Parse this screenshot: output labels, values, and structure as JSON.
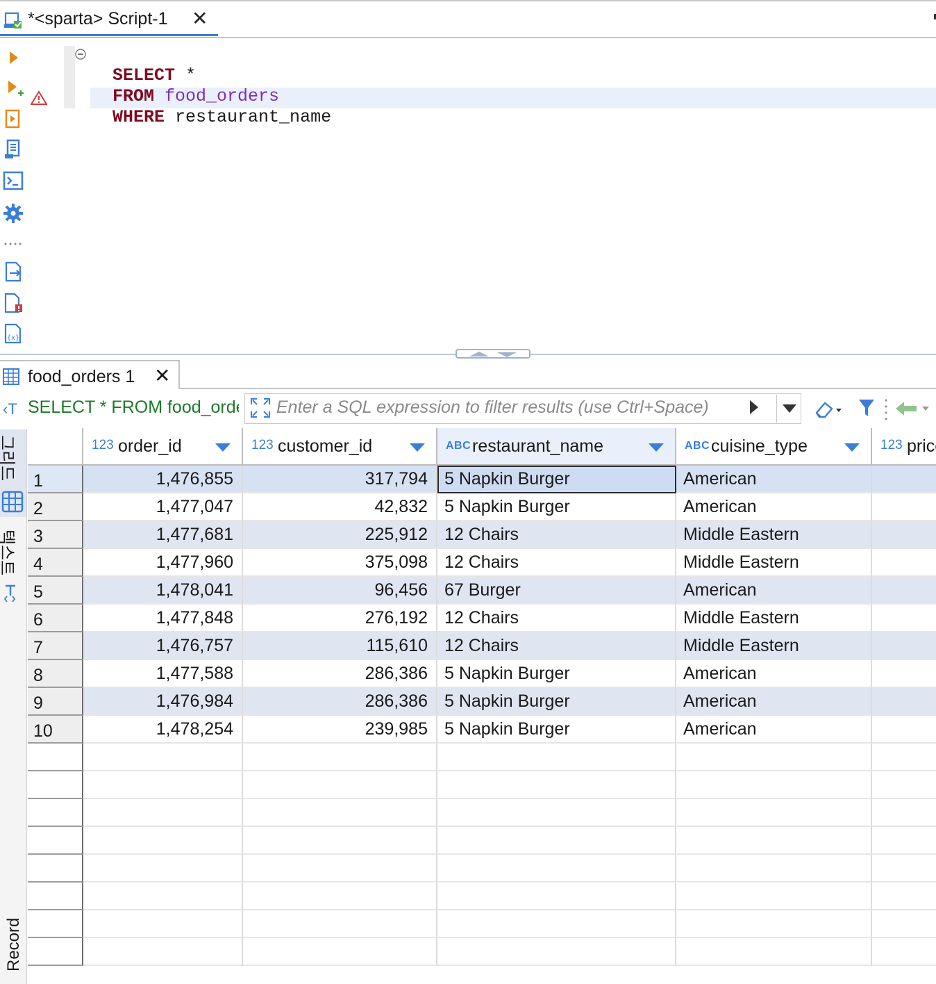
{
  "editor_tab": {
    "label": "*<sparta> Script-1",
    "close": "✕"
  },
  "editor": {
    "lines": [
      {
        "kw": "SELECT",
        "rest": " *"
      },
      {
        "kw": "FROM",
        "table": " food_orders"
      },
      {
        "kw": "WHERE",
        "rest": " restaurant_name"
      }
    ]
  },
  "left_toolbar": {
    "icons": [
      "execute-statement-icon",
      "execute-in-new-tab-icon",
      "execute-script-icon",
      "explain-plan-icon",
      "terminal-icon",
      "settings-icon",
      "more-icon",
      "export-icon",
      "error-file-icon",
      "variables-icon"
    ]
  },
  "results_tab": {
    "label": "food_orders 1",
    "close": "✕"
  },
  "filter_bar": {
    "query_text": "SELECT * FROM food_orders",
    "placeholder": "Enter a SQL expression to filter results (use Ctrl+Space)"
  },
  "side_tabs": {
    "grid_label": "그리드",
    "text_label": "텍스트",
    "record_label": "Record"
  },
  "grid": {
    "columns": [
      {
        "type": "123",
        "name": "order_id"
      },
      {
        "type": "123",
        "name": "customer_id"
      },
      {
        "type": "ABC",
        "name": "restaurant_name"
      },
      {
        "type": "ABC",
        "name": "cuisine_type"
      },
      {
        "type": "123",
        "name": "price"
      }
    ],
    "rows": [
      {
        "n": "1",
        "order_id": "1,476,855",
        "customer_id": "317,794",
        "restaurant_name": "5 Napkin Burger",
        "cuisine_type": "American"
      },
      {
        "n": "2",
        "order_id": "1,477,047",
        "customer_id": "42,832",
        "restaurant_name": "5 Napkin Burger",
        "cuisine_type": "American"
      },
      {
        "n": "3",
        "order_id": "1,477,681",
        "customer_id": "225,912",
        "restaurant_name": "12 Chairs",
        "cuisine_type": "Middle Eastern"
      },
      {
        "n": "4",
        "order_id": "1,477,960",
        "customer_id": "375,098",
        "restaurant_name": "12 Chairs",
        "cuisine_type": "Middle Eastern"
      },
      {
        "n": "5",
        "order_id": "1,478,041",
        "customer_id": "96,456",
        "restaurant_name": "67 Burger",
        "cuisine_type": "American"
      },
      {
        "n": "6",
        "order_id": "1,477,848",
        "customer_id": "276,192",
        "restaurant_name": "12 Chairs",
        "cuisine_type": "Middle Eastern"
      },
      {
        "n": "7",
        "order_id": "1,476,757",
        "customer_id": "115,610",
        "restaurant_name": "12 Chairs",
        "cuisine_type": "Middle Eastern"
      },
      {
        "n": "8",
        "order_id": "1,477,588",
        "customer_id": "286,386",
        "restaurant_name": "5 Napkin Burger",
        "cuisine_type": "American"
      },
      {
        "n": "9",
        "order_id": "1,476,984",
        "customer_id": "286,386",
        "restaurant_name": "5 Napkin Burger",
        "cuisine_type": "American"
      },
      {
        "n": "10",
        "order_id": "1,478,254",
        "customer_id": "239,985",
        "restaurant_name": "5 Napkin Burger",
        "cuisine_type": "American"
      }
    ]
  },
  "colors": {
    "accent": "#3b7ed8",
    "keyword": "#7f0b20",
    "table": "#7d2dbd",
    "row_alt": "#dfe6f1"
  }
}
